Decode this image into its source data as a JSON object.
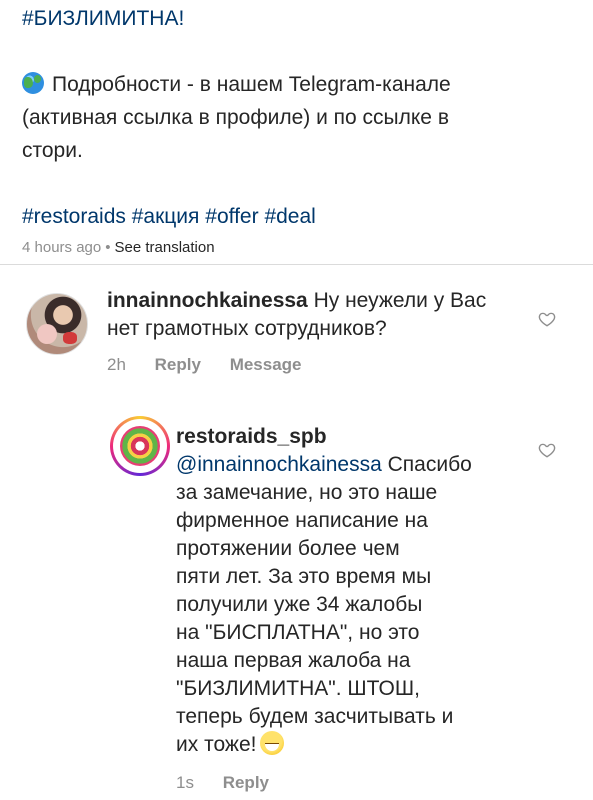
{
  "caption": {
    "line1": "#БИЗЛИМИТНА!",
    "line2": "Подробности - в нашем Telegram-канале",
    "line3": "(активная ссылка в профиле) и по ссылке в",
    "line4": "стори.",
    "hashtags": [
      "#restoraids",
      "#акция",
      "#offer",
      "#deal"
    ],
    "time": "4 hours ago",
    "separator": "•",
    "translate": "See translation",
    "globe_icon": "globe-emoji"
  },
  "comment1": {
    "username": "innainnochkainessa",
    "text_line1": "Ну неужели у Вас",
    "text_line2": "нет грамотных сотрудников?",
    "time": "2h",
    "reply": "Reply",
    "message": "Message"
  },
  "comment2": {
    "username": "restoraids_spb",
    "mention": "@innainnochkainessa",
    "lines": [
      "Спасибо",
      "за замечание, но это наше",
      "фирменное написание на",
      "протяжении более чем",
      "пяти лет. За это время мы",
      "получили уже 34 жалобы",
      "на \"БИСПЛАТНА\", но это",
      "наша первая жалоба на",
      "\"БИЗЛИМИТНА\". ШТОШ,",
      "теперь будем засчитывать и",
      "их тоже!"
    ],
    "emoji": "grinning-sweat-emoji",
    "time": "1s",
    "reply": "Reply"
  },
  "colors": {
    "hashtag": "#00376b",
    "secondary": "#8e8e8e",
    "text": "#262626",
    "divider": "#dbdbdb"
  }
}
